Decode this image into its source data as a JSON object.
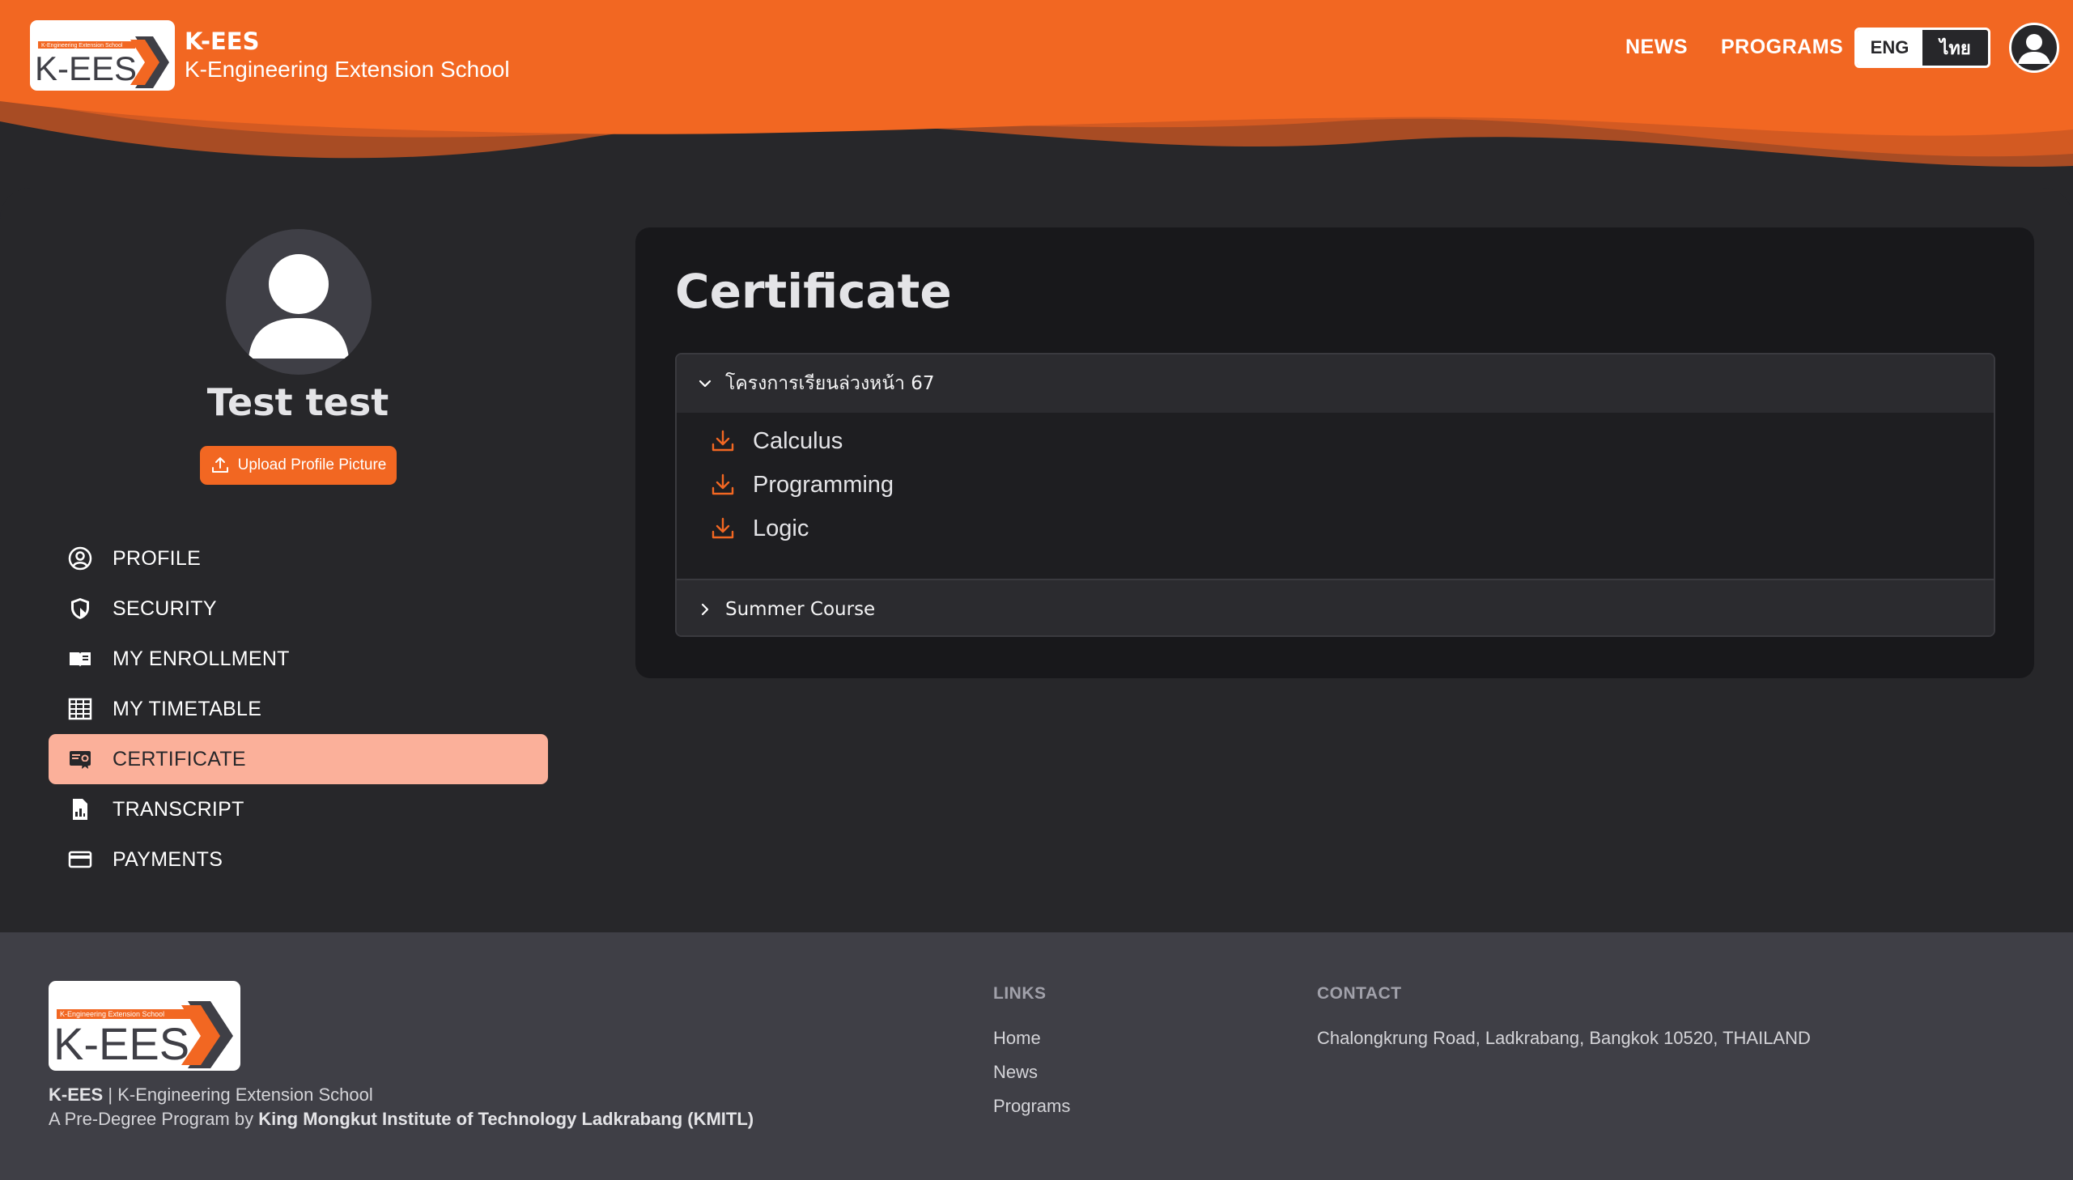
{
  "colors": {
    "brand_orange": "#f26722",
    "wave_dark": "#a84c24",
    "active_item_bg": "#fbb09a",
    "page_bg": "#27272a",
    "card_bg": "#18181b",
    "footer_bg": "#3f3f46"
  },
  "header": {
    "logo_small_text": "K-Engineering Extension School",
    "logo_text": "K-EES",
    "brand_title": "K-EES",
    "brand_subtitle": "K-Engineering Extension School",
    "nav": [
      {
        "label": "NEWS"
      },
      {
        "label": "PROGRAMS"
      }
    ],
    "lang": {
      "eng": "ENG",
      "thai": "ไทย",
      "selected": "ENG"
    },
    "account_icon": "user-circle-icon"
  },
  "profile": {
    "name": "Test test",
    "upload_label": "Upload Profile Picture",
    "avatar_icon": "user-silhouette-icon"
  },
  "sidebar": {
    "items": [
      {
        "label": "PROFILE",
        "icon": "user-circle-icon",
        "active": false
      },
      {
        "label": "SECURITY",
        "icon": "shield-icon",
        "active": false
      },
      {
        "label": "MY ENROLLMENT",
        "icon": "book-icon",
        "active": false
      },
      {
        "label": "MY TIMETABLE",
        "icon": "table-icon",
        "active": false
      },
      {
        "label": "CERTIFICATE",
        "icon": "certificate-icon",
        "active": true
      },
      {
        "label": "TRANSCRIPT",
        "icon": "document-chart-icon",
        "active": false
      },
      {
        "label": "PAYMENTS",
        "icon": "credit-card-icon",
        "active": false
      }
    ]
  },
  "certificate": {
    "title": "Certificate",
    "groups": [
      {
        "label": "โครงการเรียนล่วงหน้า 67",
        "expanded": true,
        "items": [
          {
            "label": "Calculus"
          },
          {
            "label": "Programming"
          },
          {
            "label": "Logic"
          }
        ]
      },
      {
        "label": "Summer Course",
        "expanded": false,
        "items": []
      }
    ]
  },
  "footer": {
    "logo_small_text": "K-Engineering Extension School",
    "logo_text": "K-EES",
    "brand_short": "K-EES",
    "brand_sep": " | ",
    "brand_name": "K-Engineering Extension School",
    "tagline_prefix": "A Pre-Degree Program by ",
    "institution": "King Mongkut Institute of Technology Ladkrabang (KMITL)",
    "links_heading": "LINKS",
    "links": [
      {
        "label": "Home"
      },
      {
        "label": "News"
      },
      {
        "label": "Programs"
      }
    ],
    "contact_heading": "CONTACT",
    "contact_address": "Chalongkrung Road, Ladkrabang, Bangkok 10520, THAILAND"
  }
}
